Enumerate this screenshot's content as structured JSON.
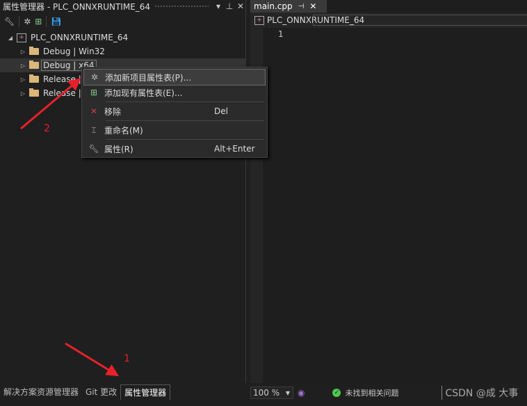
{
  "panel": {
    "title": "属性管理器 - PLC_ONNXRUNTIME_64",
    "dropdown": "▾",
    "pin": "🖈",
    "close": "✕"
  },
  "toolbar": {
    "properties": "properties-icon",
    "add_new": "add-new-icon",
    "add_existing": "add-existing-icon",
    "save": "save-icon"
  },
  "tree": {
    "project": "PLC_ONNXRUNTIME_64",
    "items": [
      {
        "label": "Debug | Win32"
      },
      {
        "label": "Debug | x64"
      },
      {
        "label": "Release | Win32"
      },
      {
        "label": "Release | x64"
      }
    ]
  },
  "menu": {
    "items": [
      {
        "label": "添加新项目属性表(P)...",
        "shortcut": ""
      },
      {
        "label": "添加现有属性表(E)...",
        "shortcut": ""
      },
      {
        "label": "移除",
        "shortcut": "Del"
      },
      {
        "label": "重命名(M)",
        "shortcut": ""
      },
      {
        "label": "属性(R)",
        "shortcut": "Alt+Enter"
      }
    ]
  },
  "bottom_tabs": [
    "解决方案资源管理器",
    "Git 更改",
    "属性管理器"
  ],
  "editor": {
    "tab": "main.cpp",
    "nav": "PLC_ONNXRUNTIME_64",
    "line": "1"
  },
  "status": {
    "zoom": "100 %",
    "issues": "未找到相关问题",
    "watermark": "CSDN @成 大事"
  },
  "annotations": [
    "2",
    "1"
  ],
  "colors": {
    "arrow": "#e8212a",
    "accent": "#c586c0"
  }
}
